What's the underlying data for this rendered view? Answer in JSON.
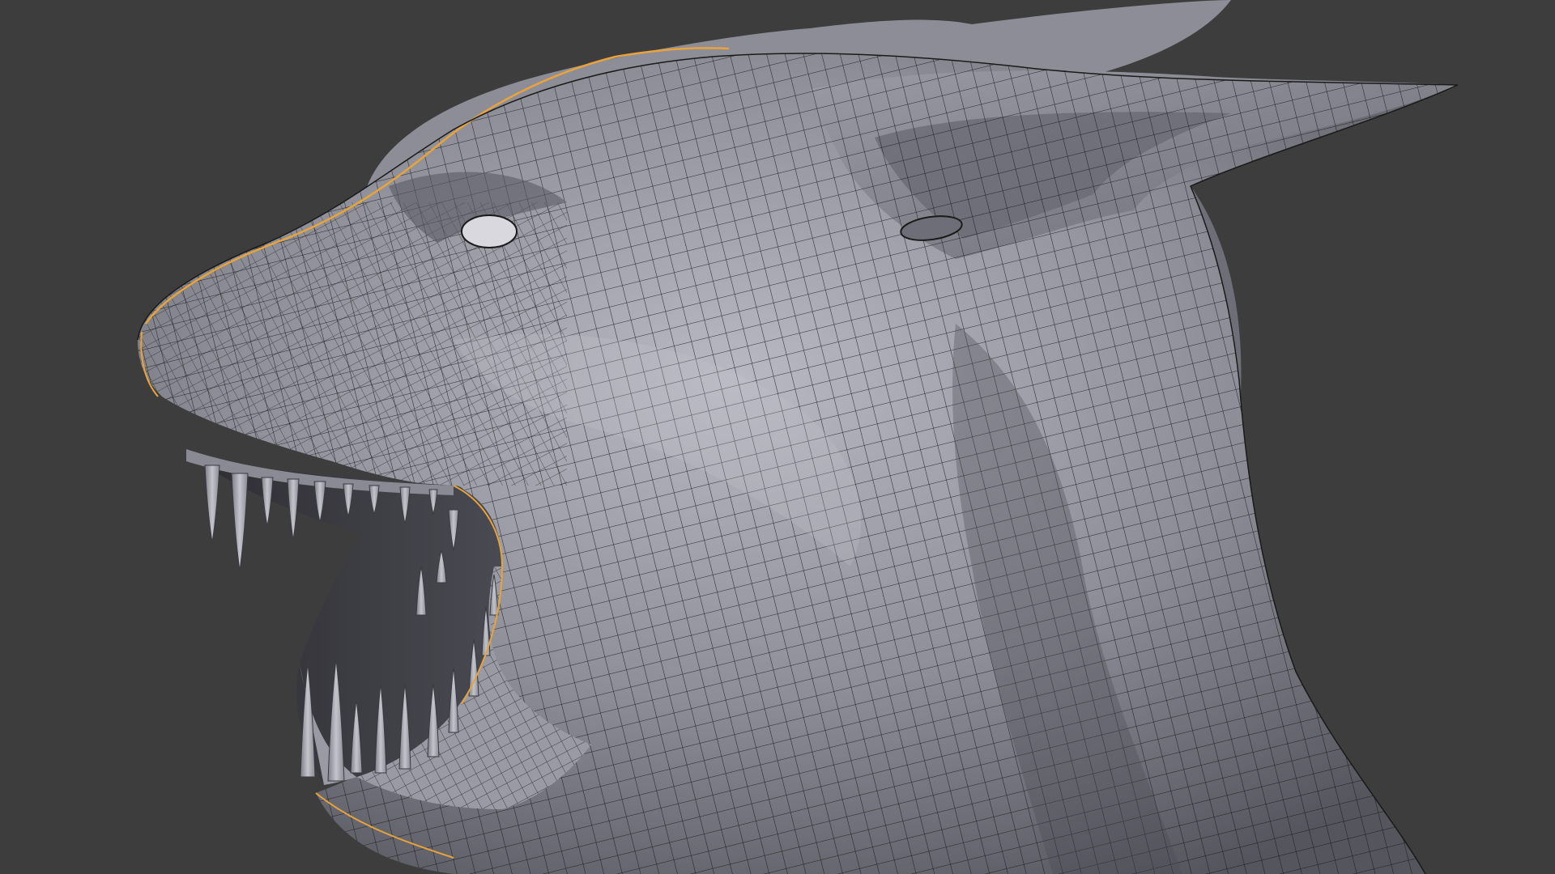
{
  "viewport": {
    "background": "#3d3d3d",
    "mesh_fill": "#8c8c96",
    "mesh_highlight": "#b4b4be",
    "mesh_shadow": "#5a5a64",
    "wire_color": "#111111",
    "edge_highlight": "#e8a33a",
    "sculpt_fill": "#7a7a84",
    "tooth_fill": "#a8a8b0"
  },
  "subject": {
    "icon": "wolf-head-retopology"
  }
}
